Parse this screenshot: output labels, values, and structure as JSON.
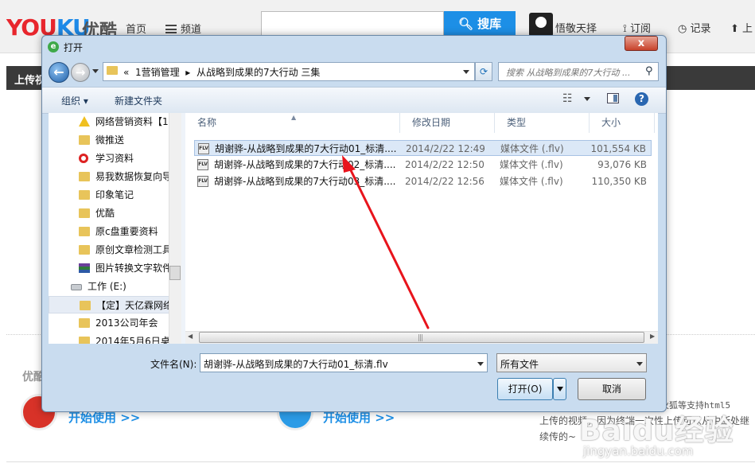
{
  "site": {
    "logo_main": "YOUKU",
    "logo_cn": "优酷",
    "nav_home": "首页",
    "nav_channel": "频道",
    "search_button": "搜库",
    "user_name": "悟敬天择",
    "nav_subscribe": "订阅",
    "nav_record": "记录",
    "nav_upload": "上",
    "dark_bar_label": "上传视",
    "section_label": "优酷",
    "start_use_1": "开始使用 >>",
    "start_use_2": "开始使用 >>",
    "right_text_1": "歌或火狐等支持html5",
    "right_text_2": "上传的视频，因为终端一次性上传可以从中断处继",
    "right_text_3": "续传的~",
    "watermark": "Baidu经验",
    "watermark_url": "jingyan.baidu.com"
  },
  "dialog": {
    "title": "打开",
    "close_label": "x",
    "address": {
      "prefix": "«",
      "segment1": "1营销管理",
      "separator": "▸",
      "segment2": "从战略到成果的7大行动 三集"
    },
    "search_placeholder": "搜索 从战略到成果的7大行动 ...",
    "toolbar": {
      "organize": "组织 ▾",
      "new_folder": "新建文件夹"
    },
    "tree": [
      {
        "label": "网络营销资料【1",
        "icon": "warning-icon"
      },
      {
        "label": "微推送",
        "icon": "folder-icon"
      },
      {
        "label": "学习资料",
        "icon": "blocked-icon"
      },
      {
        "label": "易我数据恢复向导",
        "icon": "folder-icon"
      },
      {
        "label": "印象笔记",
        "icon": "folder-icon"
      },
      {
        "label": "优酷",
        "icon": "folder-icon"
      },
      {
        "label": "原c盘重要资料",
        "icon": "folder-icon"
      },
      {
        "label": "原创文章检测工具",
        "icon": "folder-icon"
      },
      {
        "label": "图片转换文字软件",
        "icon": "winrar-icon"
      },
      {
        "label": "工作 (E:)",
        "icon": "drive-icon"
      },
      {
        "label": "【定】天亿霖网络",
        "icon": "folder-icon"
      },
      {
        "label": "2013公司年会",
        "icon": "folder-icon"
      },
      {
        "label": "2014年5月6日桌",
        "icon": "folder-icon"
      }
    ],
    "columns": {
      "name": "名称",
      "modified": "修改日期",
      "type": "类型",
      "size": "大小"
    },
    "files": [
      {
        "name": "胡谢骅-从战略到成果的7大行动01_标清....",
        "modified": "2014/2/22 12:49",
        "type": "媒体文件 (.flv)",
        "size": "101,554 KB",
        "icon_text": "FLV"
      },
      {
        "name": "胡谢骅-从战略到成果的7大行动02_标清....",
        "modified": "2014/2/22 12:50",
        "type": "媒体文件 (.flv)",
        "size": "93,076 KB",
        "icon_text": "FLV"
      },
      {
        "name": "胡谢骅-从战略到成果的7大行动03_标清....",
        "modified": "2014/2/22 12:56",
        "type": "媒体文件 (.flv)",
        "size": "110,350 KB",
        "icon_text": "FLV"
      }
    ],
    "filename_label": "文件名(N):",
    "filename_value": "胡谢骅-从战略到成果的7大行动01_标清.flv",
    "filetype_value": "所有文件",
    "open_button": "打开(O)",
    "cancel_button": "取消"
  },
  "annotation": {
    "arrow_color": "#e8141c"
  }
}
